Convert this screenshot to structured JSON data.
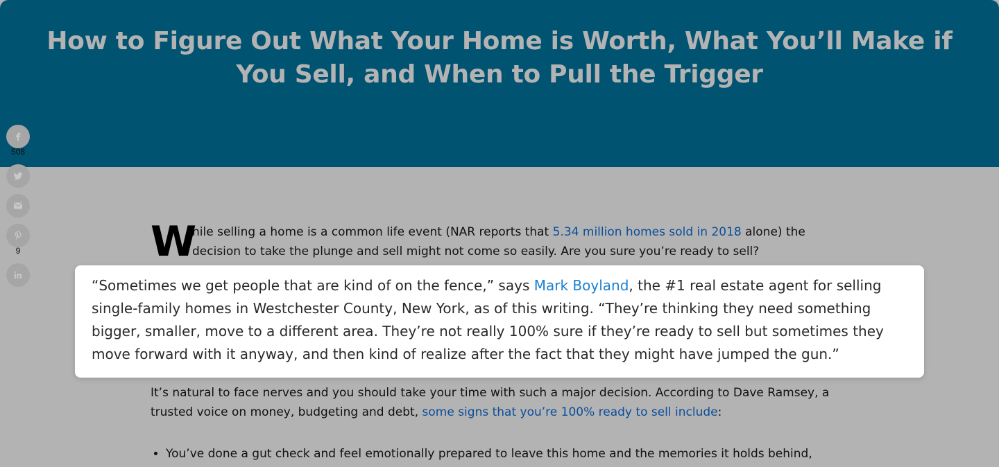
{
  "article": {
    "title": "How to Figure Out What Your Home is Worth, What You’ll Make if You Sell, and When to Pull the Trigger",
    "lead": {
      "dropcap": "W",
      "text_before_link": "hile selling a home is a common life event (NAR reports that ",
      "link_text": "5.34 million homes sold in 2018",
      "text_after_link": " alone) the decision to take the plunge and sell might not come so easily. Are you sure you’re ready to sell?"
    },
    "quote": {
      "text_before_link": "“Sometimes we get people that are kind of on the fence,” says ",
      "link_text": "Mark Boyland",
      "text_after_link": ", the #1 real estate agent for selling single-family homes in Westchester County, New York, as of this writing. “They’re thinking they need something bigger, smaller, move to a different area. They’re not really 100% sure if they’re ready to sell but sometimes they move forward with it anyway, and then kind of realize after the fact that they might have jumped the gun.”"
    },
    "para2": {
      "text_before_link": "It’s natural to face nerves and you should take your time with such a major decision. According to Dave Ramsey, a trusted voice on money, budgeting and debt, ",
      "link_text": "some signs that you’re 100% ready to sell include",
      "text_after_link": ":"
    },
    "bullets": [
      "You’ve done a gut check and feel emotionally prepared to leave this home and the memories it holds behind,"
    ]
  },
  "share": {
    "facebook_count": "508",
    "pinterest_count": "9"
  },
  "colors": {
    "hero_bg": "#005371",
    "overlay_bg": "#b3b3b3",
    "link": "#0a4e9b",
    "quote_link": "#1a7fd1"
  }
}
